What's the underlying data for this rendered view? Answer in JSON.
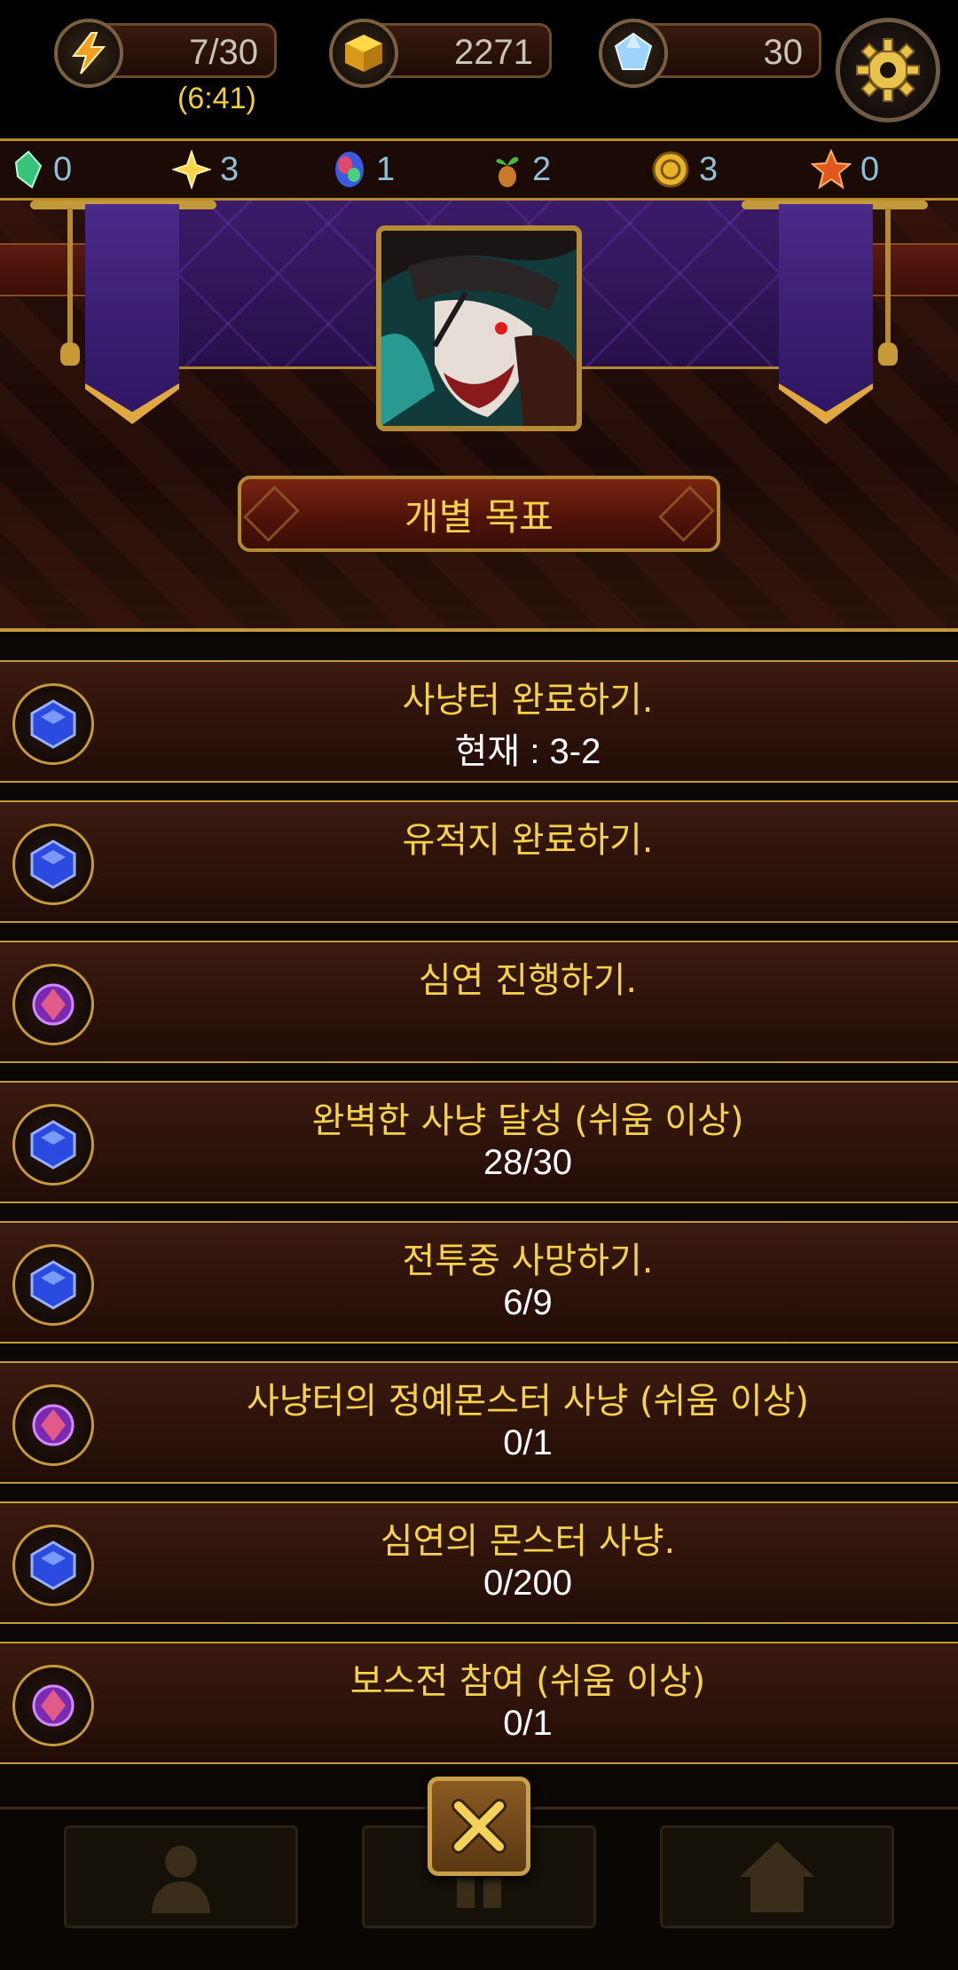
{
  "resources": {
    "energy": {
      "value": "7/30",
      "timer": "(6:41)",
      "icon": "lightning-icon"
    },
    "gold": {
      "value": "2271",
      "icon": "gold-cube-icon"
    },
    "gems": {
      "value": "30",
      "icon": "diamond-icon"
    },
    "settings_icon": "gear-icon"
  },
  "items": [
    {
      "icon": "green-crystal-icon",
      "count": "0"
    },
    {
      "icon": "yellow-star-icon",
      "count": "3"
    },
    {
      "icon": "rainbow-gem-icon",
      "count": "1"
    },
    {
      "icon": "sprout-icon",
      "count": "2"
    },
    {
      "icon": "gold-coin-icon",
      "count": "3"
    },
    {
      "icon": "red-star-icon",
      "count": "0"
    }
  ],
  "header": {
    "portrait": "hero-portrait",
    "title": "개별 목표"
  },
  "goals": [
    {
      "title": "사냥터 완료하기.",
      "progress": "현재 : 3-2",
      "reward": "blue-gem"
    },
    {
      "title": "유적지 완료하기.",
      "progress": "",
      "reward": "blue-gem"
    },
    {
      "title": "심연 진행하기.",
      "progress": "",
      "reward": "purple-gem"
    },
    {
      "title": "완벽한 사냥 달성 (쉬움 이상)",
      "progress": "28/30",
      "reward": "blue-gem"
    },
    {
      "title": "전투중 사망하기.",
      "progress": "6/9",
      "reward": "blue-gem"
    },
    {
      "title": "사냥터의 정예몬스터 사냥 (쉬움 이상)",
      "progress": "0/1",
      "reward": "purple-gem"
    },
    {
      "title": "심연의 몬스터 사냥.",
      "progress": "0/200",
      "reward": "blue-gem"
    },
    {
      "title": "보스전 참여 (쉬움 이상)",
      "progress": "0/1",
      "reward": "purple-gem"
    }
  ],
  "nav": {
    "left_icon": "person-icon",
    "center_icon": "grid-icon",
    "right_icon": "home-icon",
    "close_icon": "close-icon"
  },
  "colors": {
    "gold_text": "#f5d24a",
    "white_text": "#ffffff",
    "border_gold": "#c39a3a",
    "banner_purple": "#3b1b6a"
  }
}
